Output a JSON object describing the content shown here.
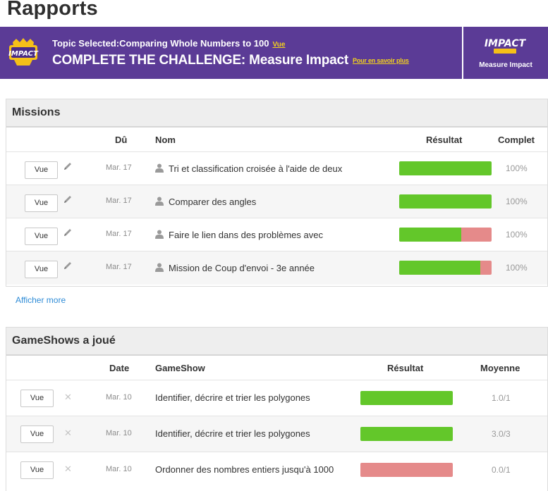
{
  "page": {
    "title": "Rapports"
  },
  "banner": {
    "topic_label": "Topic Selected:Comparing Whole Numbers to 100",
    "topic_link": "Vue",
    "challenge_label": "COMPLETE THE CHALLENGE: Measure Impact",
    "challenge_link": "Pour en savoir plus",
    "badge_text": "IMPACT",
    "logo_text": "IMPACT",
    "logo_sub": "Measure Impact",
    "color": "#5b3b96",
    "link_color": "#f5d31b"
  },
  "missions": {
    "title": "Missions",
    "columns": {
      "due": "Dû",
      "name": "Nom",
      "result": "Résultat",
      "complete": "Complet"
    },
    "rows": [
      {
        "view": "Vue",
        "date": "Mar. 17",
        "name": "Tri et classification croisée à l'aide de deux",
        "score": 1.0,
        "complete": "100%"
      },
      {
        "view": "Vue",
        "date": "Mar. 17",
        "name": "Comparer des angles",
        "score": 1.0,
        "complete": "100%"
      },
      {
        "view": "Vue",
        "date": "Mar. 17",
        "name": "Faire le lien dans des problèmes avec",
        "score": 0.67,
        "complete": "100%"
      },
      {
        "view": "Vue",
        "date": "Mar. 17",
        "name": "Mission de Coup d'envoi - 3e année",
        "score": 0.88,
        "complete": "100%"
      }
    ],
    "more": "Afficher more"
  },
  "gameshows": {
    "title": "GameShows a joué",
    "columns": {
      "date": "Date",
      "name": "GameShow",
      "result": "Résultat",
      "average": "Moyenne"
    },
    "rows": [
      {
        "view": "Vue",
        "date": "Mar. 10",
        "name": "Identifier, décrire et trier les polygones",
        "score": 1.0,
        "average": "1.0/1"
      },
      {
        "view": "Vue",
        "date": "Mar. 10",
        "name": "Identifier, décrire et trier les polygones",
        "score": 1.0,
        "average": "3.0/3"
      },
      {
        "view": "Vue",
        "date": "Mar. 10",
        "name": "Ordonner des nombres entiers jusqu'à 1000",
        "score": 0.0,
        "average": "0.0/1"
      }
    ]
  },
  "colors": {
    "bar_correct": "#63c72a",
    "bar_incorrect": "#e58a8a",
    "link": "#2d8bd6"
  },
  "icons": {
    "edit": "pencil-icon",
    "delete": "x-icon",
    "student": "person-icon"
  }
}
